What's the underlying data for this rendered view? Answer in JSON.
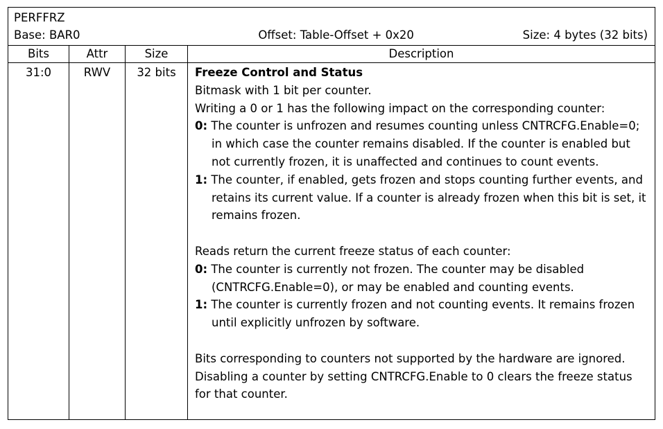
{
  "register": {
    "name": "PERFFRZ",
    "base": "Base: BAR0",
    "offset": "Offset: Table-Offset + 0x20",
    "size": "Size: 4 bytes (32 bits)"
  },
  "columns": {
    "bits": "Bits",
    "attr": "Attr",
    "size": "Size",
    "description": "Description"
  },
  "field": {
    "bits": "31:0",
    "attr": "RWV",
    "size": "32 bits",
    "title": "Freeze Control and Status",
    "p1": "Bitmask with 1 bit per counter.",
    "p2": "Writing a 0 or 1 has the following impact on the corresponding counter:",
    "w0_key": "0:",
    "w0_text": "The counter is unfrozen and resumes counting unless CNTRCFG.Enable=0; in which case the counter remains disabled. If the counter is enabled but not currently frozen, it is unaffected and continues to count events.",
    "w1_key": "1:",
    "w1_text": "The counter, if enabled, gets frozen and stops counting further events, and retains its current value. If a counter is already frozen when this bit is set, it remains frozen.",
    "p3": "Reads return the current freeze status of each counter:",
    "r0_key": "0:",
    "r0_text": "The counter is currently not frozen. The counter may be disabled (CNTRCFG.Enable=0), or may be enabled and counting events.",
    "r1_key": "1:",
    "r1_text": "The counter is currently frozen and not counting events. It remains frozen until explicitly unfrozen by software.",
    "p4": "Bits corresponding to counters not supported by the hardware are ignored. Disabling a counter by setting CNTRCFG.Enable to 0 clears the freeze status for that counter."
  }
}
